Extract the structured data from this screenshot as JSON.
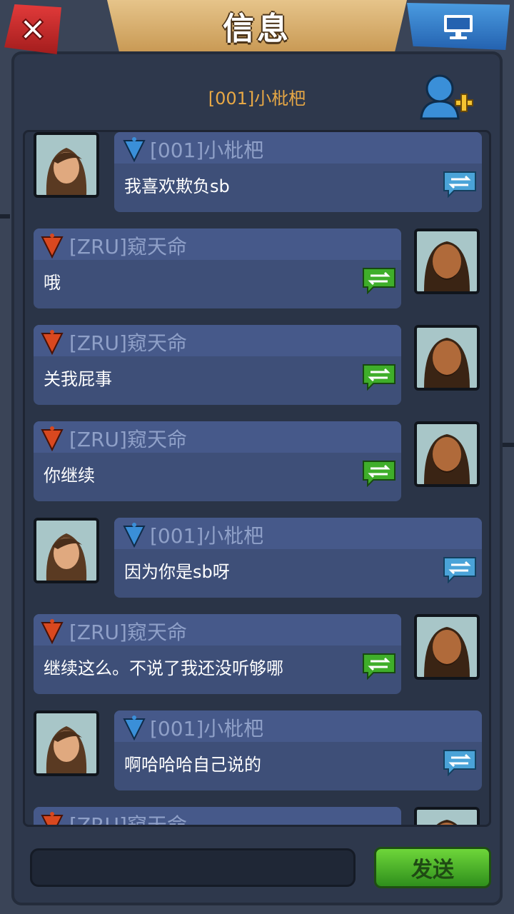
{
  "header": {
    "title": "信息",
    "close_icon": "close-icon",
    "screen_icon": "monitor-icon"
  },
  "conversation": {
    "title": "[001]小枇杷",
    "add_friend_icon": "add-friend-icon"
  },
  "messages": [
    {
      "side": "left",
      "avatar": "female-avatar",
      "team": "blue",
      "name": "[001]小枇杷",
      "text": "我喜欢欺负sb"
    },
    {
      "side": "right",
      "avatar": "bearded-male-avatar",
      "team": "red",
      "name": "[ZRU]窥天命",
      "text": "哦"
    },
    {
      "side": "right",
      "avatar": "bearded-male-avatar",
      "team": "red",
      "name": "[ZRU]窥天命",
      "text": "关我屁事"
    },
    {
      "side": "right",
      "avatar": "bearded-male-avatar",
      "team": "red",
      "name": "[ZRU]窥天命",
      "text": "你继续"
    },
    {
      "side": "left",
      "avatar": "female-avatar",
      "team": "blue",
      "name": "[001]小枇杷",
      "text": "因为你是sb呀"
    },
    {
      "side": "right",
      "avatar": "bearded-male-avatar",
      "team": "red",
      "name": "[ZRU]窥天命",
      "text": "继续这么。不说了我还没听够哪"
    },
    {
      "side": "left",
      "avatar": "female-avatar",
      "team": "blue",
      "name": "[001]小枇杷",
      "text": "啊哈哈哈自己说的"
    },
    {
      "side": "right",
      "avatar": "bearded-male-avatar",
      "team": "red",
      "name": "[ZRU]窥天命",
      "text": ""
    }
  ],
  "composer": {
    "send_label": "发送",
    "input_value": ""
  },
  "colors": {
    "accent_orange": "#e8a845",
    "blue_team": "#3a8fd8",
    "red_team": "#d9481f",
    "reply_blue": "#4aa3d8",
    "reply_green": "#3fae2a"
  }
}
